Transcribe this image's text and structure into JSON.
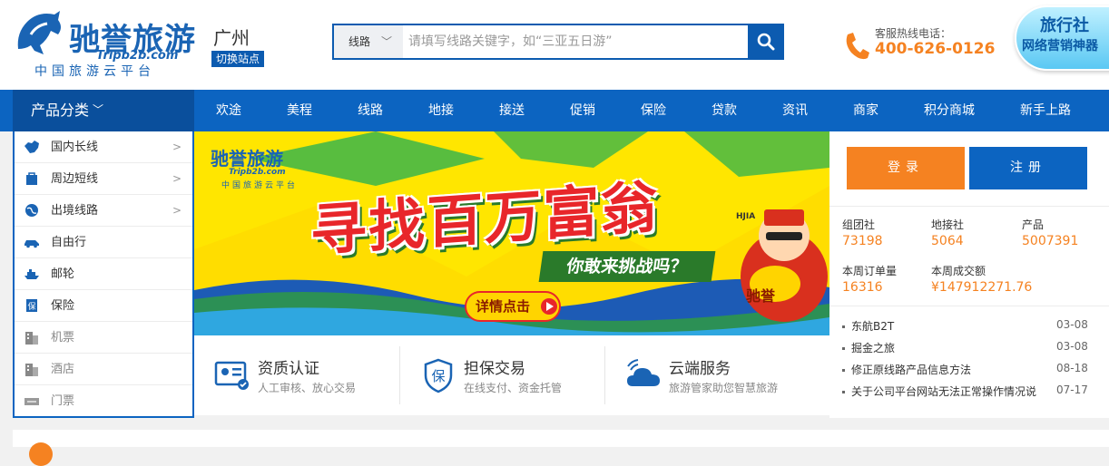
{
  "header": {
    "logo_title": "驰誉旅游",
    "logo_domain": "Tripb2b.com",
    "logo_slogan": "中国旅游云平台",
    "city": "广州",
    "switch_site_label": "切换站点",
    "search": {
      "category": "线路",
      "placeholder": "请填写线路关键字，如“三亚五日游”"
    },
    "hotline_label": "客服热线电话：",
    "hotline_number": "400-626-0126",
    "promo_line1": "旅行社",
    "promo_line2": "网络营销神器"
  },
  "nav": {
    "category_label": "产品分类",
    "items": [
      "欢途",
      "美程",
      "线路",
      "地接",
      "接送",
      "促销",
      "保险",
      "贷款",
      "资讯",
      "商家",
      "积分商城",
      "新手上路"
    ]
  },
  "sidebar": {
    "items": [
      {
        "label": "国内长线",
        "icon": "china-map-icon"
      },
      {
        "label": "周边短线",
        "icon": "bag-icon"
      },
      {
        "label": "出境线路",
        "icon": "globe-icon"
      },
      {
        "label": "自由行",
        "icon": "car-icon"
      },
      {
        "label": "邮轮",
        "icon": "ship-icon"
      },
      {
        "label": "保险",
        "icon": "insurance-icon"
      },
      {
        "label": "机票",
        "icon": "building-icon"
      },
      {
        "label": "酒店",
        "icon": "hotel-icon"
      },
      {
        "label": "门票",
        "icon": "ticket-icon"
      }
    ]
  },
  "banner": {
    "logo_title": "驰誉旅游",
    "logo_domain": "Tripb2b.com",
    "logo_slogan": "中国旅游云平台",
    "headline": "寻找百万富翁",
    "subtitle": "你敢来挑战吗？",
    "detail_button": "详情点击",
    "character_tag": "HJIA",
    "seal_text": "驰誉"
  },
  "features": [
    {
      "title": "资质认证",
      "desc": "人工审核、放心交易",
      "icon": "id-card-icon"
    },
    {
      "title": "担保交易",
      "desc": "在线支付、资金托管",
      "icon": "shield-icon"
    },
    {
      "title": "云端服务",
      "desc": "旅游管家助您智慧旅游",
      "icon": "cloud-icon"
    }
  ],
  "account": {
    "login_label": "登录",
    "register_label": "注册"
  },
  "stats": [
    {
      "label": "组团社",
      "value": "73198"
    },
    {
      "label": "地接社",
      "value": "5064"
    },
    {
      "label": "产品",
      "value": "5007391"
    },
    {
      "label": "本周订单量",
      "value": "16316"
    },
    {
      "label": "本周成交额",
      "value": "¥147912271.76"
    }
  ],
  "news": [
    {
      "title": "东航B2T",
      "date": "03-08"
    },
    {
      "title": "掘金之旅",
      "date": "03-08"
    },
    {
      "title": "修正原线路产品信息方法",
      "date": "08-18"
    },
    {
      "title": "关于公司平台网站无法正常操作情况说",
      "date": "07-17"
    }
  ],
  "colors": {
    "brand_blue": "#0c64c1",
    "accent_orange": "#f58221",
    "banner_yellow": "#ffdd00",
    "banner_red": "#e8262a"
  }
}
